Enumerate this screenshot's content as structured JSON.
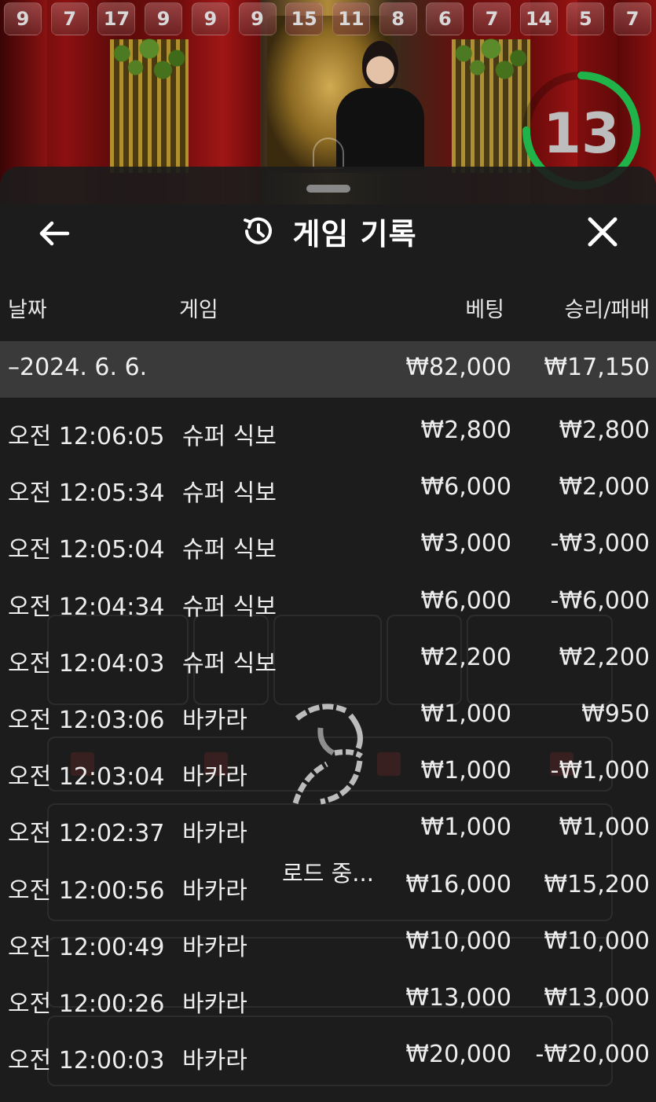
{
  "top_numbers": [
    "9",
    "7",
    "17",
    "9",
    "9",
    "9",
    "15",
    "11",
    "8",
    "6",
    "7",
    "14",
    "5",
    "7"
  ],
  "timer": {
    "value": "13",
    "accent": "#1fb34a"
  },
  "header": {
    "title": "게임 기록",
    "back_icon": "arrow-left-icon",
    "history_icon": "history-icon",
    "close_icon": "close-icon"
  },
  "columns": {
    "date": "날짜",
    "game": "게임",
    "bet": "베팅",
    "win_loss": "승리/패배"
  },
  "group": {
    "date": "–2024. 6. 6.",
    "bet": "₩82,000",
    "win_loss": "₩17,150"
  },
  "rows": [
    {
      "time": "오전 12:06:05",
      "game": "슈퍼 식보",
      "bet": "₩2,800",
      "win_loss": "₩2,800"
    },
    {
      "time": "오전 12:05:34",
      "game": "슈퍼 식보",
      "bet": "₩6,000",
      "win_loss": "₩2,000"
    },
    {
      "time": "오전 12:05:04",
      "game": "슈퍼 식보",
      "bet": "₩3,000",
      "win_loss": "-₩3,000"
    },
    {
      "time": "오전 12:04:34",
      "game": "슈퍼 식보",
      "bet": "₩6,000",
      "win_loss": "-₩6,000"
    },
    {
      "time": "오전 12:04:03",
      "game": "슈퍼 식보",
      "bet": "₩2,200",
      "win_loss": "₩2,200"
    },
    {
      "time": "오전 12:03:06",
      "game": "바카라",
      "bet": "₩1,000",
      "win_loss": "₩950"
    },
    {
      "time": "오전 12:03:04",
      "game": "바카라",
      "bet": "₩1,000",
      "win_loss": "-₩1,000"
    },
    {
      "time": "오전 12:02:37",
      "game": "바카라",
      "bet": "₩1,000",
      "win_loss": "₩1,000"
    },
    {
      "time": "오전 12:00:56",
      "game": "바카라",
      "bet": "₩16,000",
      "win_loss": "₩15,200"
    },
    {
      "time": "오전 12:00:49",
      "game": "바카라",
      "bet": "₩10,000",
      "win_loss": "₩10,000"
    },
    {
      "time": "오전 12:00:26",
      "game": "바카라",
      "bet": "₩13,000",
      "win_loss": "₩13,000"
    },
    {
      "time": "오전 12:00:03",
      "game": "바카라",
      "bet": "₩20,000",
      "win_loss": "-₩20,000"
    }
  ],
  "loading": {
    "text": "로드 중...",
    "icon": "loading-spinner-icon"
  }
}
